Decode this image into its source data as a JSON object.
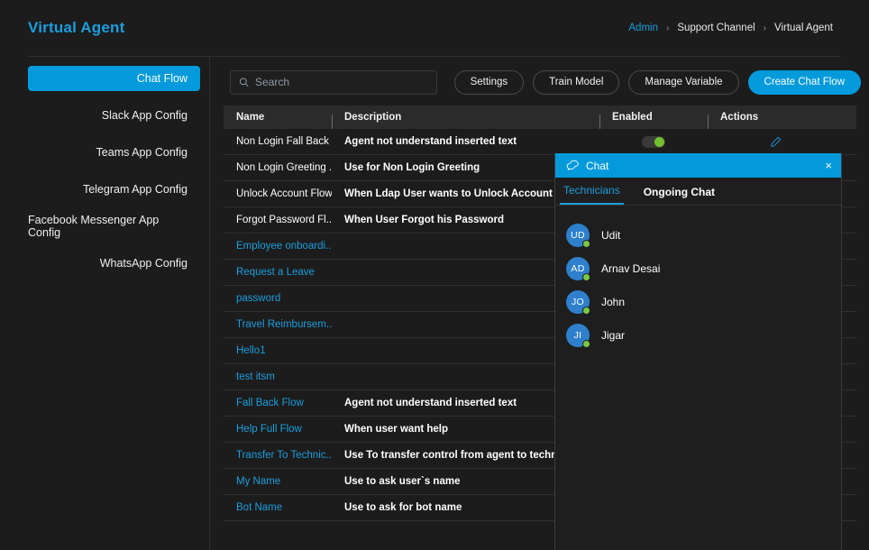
{
  "header": {
    "title": "Virtual Agent",
    "breadcrumb": [
      {
        "label": "Admin",
        "type": "link"
      },
      {
        "label": "Support Channel",
        "type": "text"
      },
      {
        "label": "Virtual Agent",
        "type": "text"
      }
    ],
    "separator": "›"
  },
  "sidebar": {
    "items": [
      {
        "label": "Chat Flow",
        "active": true
      },
      {
        "label": "Slack App Config",
        "active": false
      },
      {
        "label": "Teams App Config",
        "active": false
      },
      {
        "label": "Telegram App Config",
        "active": false
      },
      {
        "label": "Facebook Messenger App Config",
        "active": false
      },
      {
        "label": "WhatsApp Config",
        "active": false
      }
    ]
  },
  "toolbar": {
    "search_placeholder": "Search",
    "search_value": "",
    "settings_label": "Settings",
    "train_model_label": "Train Model",
    "manage_variable_label": "Manage Variable",
    "create_chat_flow_label": "Create Chat Flow"
  },
  "table": {
    "columns": [
      "Name",
      "Description",
      "Enabled",
      "Actions"
    ],
    "rows": [
      {
        "name": "Non Login Fall Back ...",
        "description": "Agent not understand inserted text",
        "link": false,
        "enabled": true,
        "edit": true
      },
      {
        "name": "Non Login Greeting ...",
        "description": "Use for Non Login Greeting",
        "link": false,
        "enabled": null,
        "edit": false
      },
      {
        "name": "Unlock Account Flow",
        "description": "When Ldap User wants to Unlock Account",
        "link": false,
        "enabled": null,
        "edit": false
      },
      {
        "name": "Forgot Password Fl...",
        "description": "When User Forgot his Password",
        "link": false,
        "enabled": null,
        "edit": false
      },
      {
        "name": "Employee onboardi...",
        "description": "",
        "link": true,
        "enabled": null,
        "edit": false
      },
      {
        "name": "Request a Leave",
        "description": "",
        "link": true,
        "enabled": null,
        "edit": false
      },
      {
        "name": "password",
        "description": "",
        "link": true,
        "enabled": null,
        "edit": false
      },
      {
        "name": "Travel Reimbursem...",
        "description": "",
        "link": true,
        "enabled": null,
        "edit": false
      },
      {
        "name": "Hello1",
        "description": "",
        "link": true,
        "enabled": null,
        "edit": false
      },
      {
        "name": "test itsm",
        "description": "",
        "link": true,
        "enabled": null,
        "edit": false
      },
      {
        "name": "Fall Back Flow",
        "description": "Agent not understand inserted text",
        "link": true,
        "enabled": null,
        "edit": false
      },
      {
        "name": "Help Full Flow",
        "description": "When user want help",
        "link": true,
        "enabled": null,
        "edit": false
      },
      {
        "name": "Transfer To Technic...",
        "description": "Use To transfer control from agent to technician",
        "link": true,
        "enabled": null,
        "edit": false
      },
      {
        "name": "My Name",
        "description": "Use to ask user`s name",
        "link": true,
        "enabled": null,
        "edit": false
      },
      {
        "name": "Bot Name",
        "description": "Use to ask for bot name",
        "link": true,
        "enabled": null,
        "edit": false
      }
    ]
  },
  "chat_panel": {
    "title": "Chat",
    "close_label": "×",
    "tabs": [
      {
        "label": "Technicians",
        "active": true
      },
      {
        "label": "Ongoing Chat",
        "active": false
      }
    ],
    "technicians": [
      {
        "initials": "UD",
        "name": "Udit",
        "online": true
      },
      {
        "initials": "AD",
        "name": "Arnav Desai",
        "online": true
      },
      {
        "initials": "JO",
        "name": "John",
        "online": true
      },
      {
        "initials": "JI",
        "name": "Jigar",
        "online": true
      }
    ]
  },
  "colors": {
    "accent": "#029ada",
    "link": "#1b9ede",
    "online": "#7ac943",
    "avatar": "#2e80cd",
    "background": "#1c1c1c"
  }
}
